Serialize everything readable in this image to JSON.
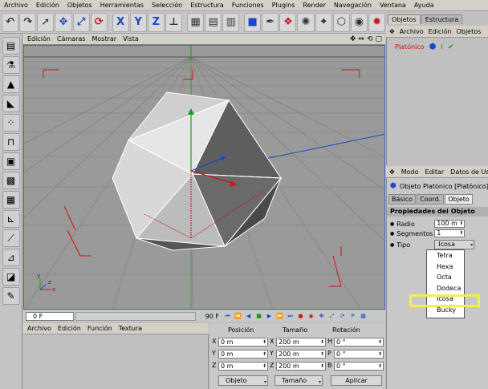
{
  "menubar": [
    "Archivo",
    "Edición",
    "Objetos",
    "Herramientas",
    "Selección",
    "Estructura",
    "Funciones",
    "Plugins",
    "Render",
    "Navegación",
    "Ventana",
    "Ayuda"
  ],
  "toolbar": {
    "axis_x": "X",
    "axis_y": "Y",
    "axis_z": "Z"
  },
  "viewport": {
    "menu": [
      "Edición",
      "Cámaras",
      "Mostrar",
      "Vista"
    ]
  },
  "timeline": {
    "start_frame": "0 F",
    "end_frame": "90 F"
  },
  "material": {
    "menu": [
      "Archivo",
      "Edición",
      "Función",
      "Textura"
    ]
  },
  "coords": {
    "headers": {
      "position": "Posición",
      "size": "Tamaño",
      "rotation": "Rotación"
    },
    "rows": [
      {
        "pos_label": "X",
        "pos": "0 m",
        "size_label": "X",
        "size": "200 m",
        "rot_label": "H",
        "rot": "0 °"
      },
      {
        "pos_label": "Y",
        "pos": "0 m",
        "size_label": "Y",
        "size": "200 m",
        "rot_label": "P",
        "rot": "0 °"
      },
      {
        "pos_label": "Z",
        "pos": "0 m",
        "size_label": "Z",
        "size": "200 m",
        "rot_label": "B",
        "rot": "0 °"
      }
    ],
    "mode_select": "Objeto",
    "size_select": "Tamaño",
    "apply_label": "Aplicar"
  },
  "objects_panel": {
    "tabs": [
      "Objetos",
      "Estructura"
    ],
    "menu": [
      "Archivo",
      "Edición",
      "Objetos"
    ],
    "items": [
      {
        "name": "Platónico"
      }
    ]
  },
  "attributes": {
    "menu": [
      "Modo",
      "Editar",
      "Datos de Usuario"
    ],
    "title": "Objeto Platónico [Platónico]",
    "tabs": [
      "Básico",
      "Coord.",
      "Objeto"
    ],
    "section": "Propiedades del Objeto",
    "radius_label": "Radio",
    "radius_value": "100 m",
    "segments_label": "Segmentos",
    "segments_value": "1",
    "type_label": "Tipo",
    "type_value": "Icosa",
    "type_options": [
      "Tetra",
      "Hexa",
      "Octa",
      "Dodeca",
      "Icosa",
      "Bucky"
    ]
  },
  "colors": {
    "accent": "#3a5fcd",
    "highlight": "#f4ef4c",
    "object_name": "#d01010",
    "grid_line": "#7c7c7c",
    "axis_x": "#d01010",
    "axis_y": "#1a9a1a",
    "axis_z": "#1b48c4"
  }
}
